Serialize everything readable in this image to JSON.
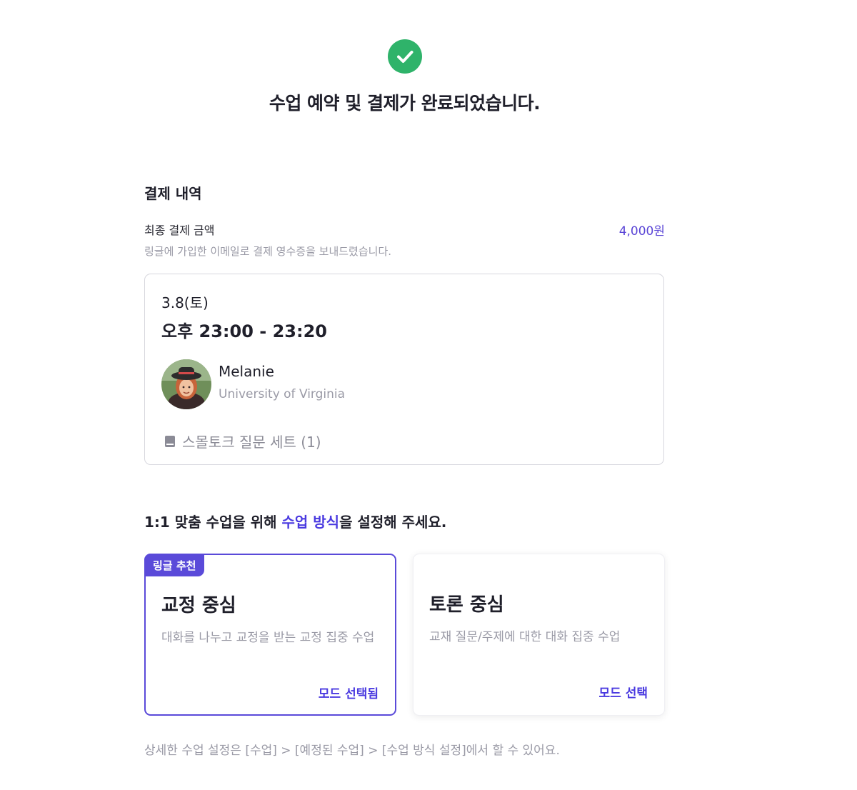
{
  "header": {
    "title": "수업 예약 및 결제가 완료되었습니다."
  },
  "payment": {
    "heading": "결제 내역",
    "amount_label": "최종 결제 금액",
    "amount_value": "4,000원",
    "receipt_note": "링글에 가입한 이메일로 결제 영수증을 보내드렸습니다."
  },
  "lesson": {
    "date": "3.8(토)",
    "time": "오후 23:00 - 23:20",
    "tutor_name": "Melanie",
    "tutor_school": "University of Virginia",
    "material": "스몰토크 질문 세트 (1)",
    "material_icon": "book-icon"
  },
  "mode_selection": {
    "heading_prefix": "1:1 맞춤 수업을 위해 ",
    "heading_highlight": "수업 방식",
    "heading_suffix": "을 설정해 주세요.",
    "cards": [
      {
        "badge": "링글 추천",
        "title": "교정 중심",
        "description": "대화를 나누고 교정을 받는 교정 집중 수업",
        "action": "모드 선택됨",
        "selected": true
      },
      {
        "title": "토론 중심",
        "description": "교재 질문/주제에 대한 대화 집중 수업",
        "action": "모드 선택",
        "selected": false
      }
    ]
  },
  "footer": {
    "note": "상세한 수업 설정은 [수업] > [예정된 수업] > [수업 방식 설정]에서 할 수 있어요."
  },
  "colors": {
    "success": "#2fb36a",
    "accent": "#5a4ad9",
    "link": "#4a3ae0",
    "muted_text": "#9a9aa6"
  }
}
